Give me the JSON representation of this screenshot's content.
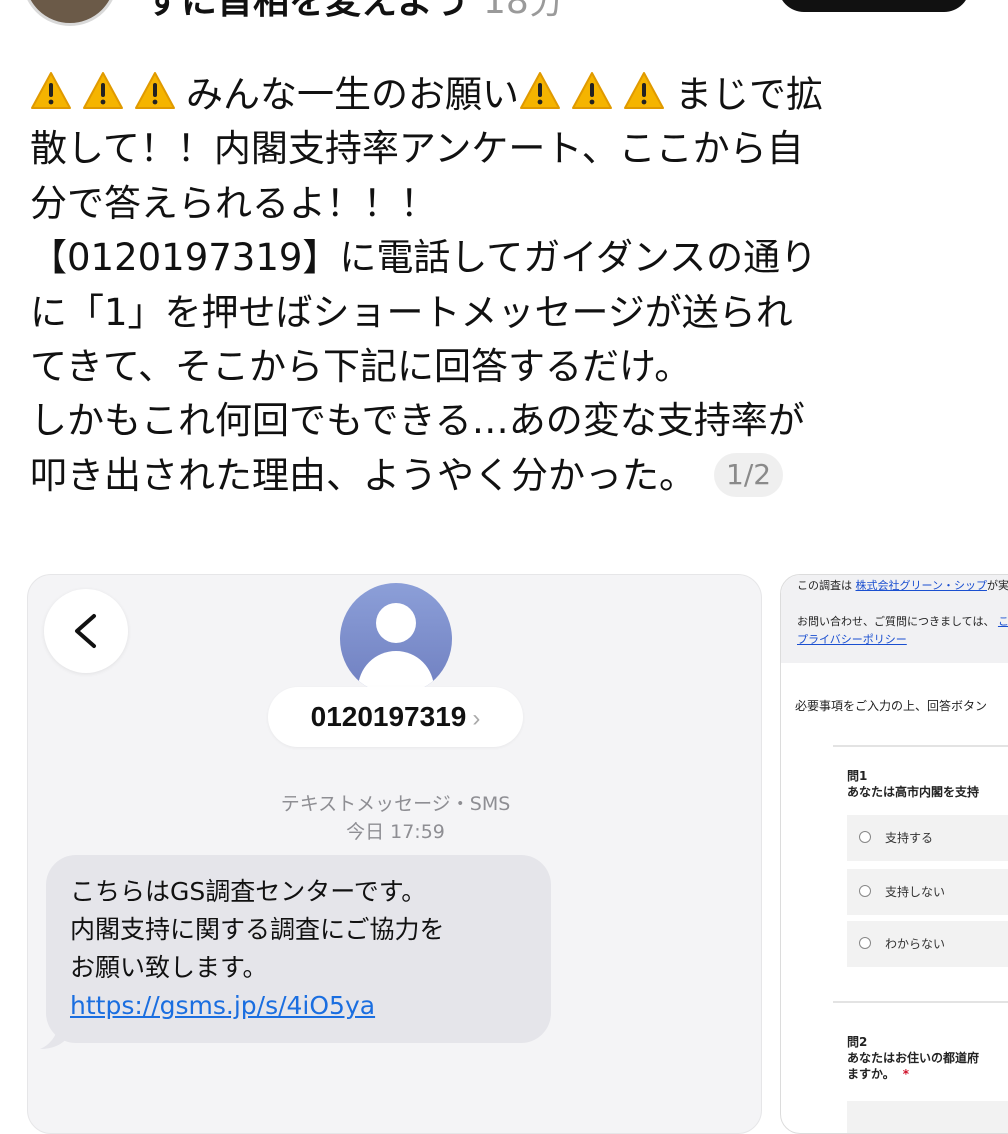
{
  "header": {
    "name_partial": "すに首相を変えよう",
    "time": "18分"
  },
  "post": {
    "line1_text1": "みんな一生のお願い",
    "line1_text2": "まじで拡",
    "line2": "散して！！内閣支持率アンケート、ここから自",
    "line3": "分で答えられるよ！！！",
    "line4": "【0120197319】に電話してガイダンスの通り",
    "line5": "に「1」を押せばショートメッセージが送られ",
    "line6": "てきて、そこから下記に回答するだけ。",
    "line7": "しかもこれ何回でもできる…あの変な支持率が",
    "line8": "叩き出された理由、ようやく分かった。",
    "page_indicator": "1/2",
    "warning_icon": "warning-emoji-icon"
  },
  "sms": {
    "number": "0120197319",
    "number_chevron": "›",
    "channel": "テキストメッセージ・SMS",
    "time": "今日 17:59",
    "message_lines": [
      "こちらはGS調査センターです。",
      "内閣支持に関する調査にご協力を",
      "お願い致します。"
    ],
    "link": "https://gsms.jp/s/4iO5ya"
  },
  "survey": {
    "intro_prefix": "この調査は",
    "company_link": "株式会社グリーン・シップ",
    "intro_suffix": "が実",
    "contact_text": "お問い合わせ、ご質問につきましては、",
    "contact_link": "こ",
    "privacy_link": "プライバシーポリシー",
    "instructions": "必要事項をご入力の上、回答ボタン",
    "q1": {
      "number": "問1",
      "text": "あなたは高市内閣を支持",
      "options": [
        "支持する",
        "支持しない",
        "わからない"
      ]
    },
    "q2": {
      "number": "問2",
      "text_line1": "あなたはお住いの都道府",
      "text_line2": "ますか。",
      "required_mark": "*"
    }
  },
  "colors": {
    "text": "#111111",
    "muted": "#9a9a9a",
    "sms_bubble": "#e5e5ea",
    "link_blue": "#1a6ee0",
    "required_red": "#d0102a"
  }
}
